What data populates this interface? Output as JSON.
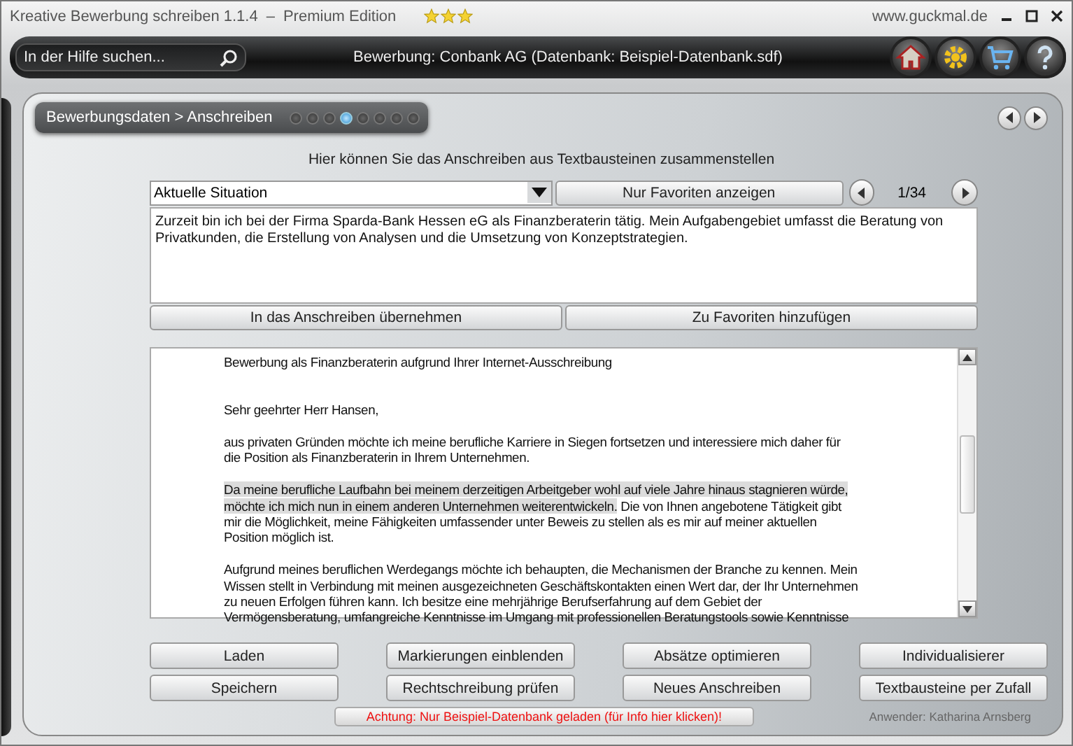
{
  "window": {
    "title": "Kreative Bewerbung schreiben 1.1.4",
    "separator": "–",
    "edition": "Premium Edition",
    "stars": 3,
    "website": "www.guckmal.de"
  },
  "toolbar": {
    "search": {
      "placeholder": "In der Hilfe suchen..."
    },
    "caption": "Bewerbung: Conbank AG (Datenbank: Beispiel-Datenbank.sdf)"
  },
  "breadcrumb": "Bewerbungsdaten > Anschreiben",
  "steps": [
    {
      "selected": false
    },
    {
      "selected": false
    },
    {
      "selected": false
    },
    {
      "selected": true
    },
    {
      "selected": false
    },
    {
      "selected": false
    },
    {
      "selected": false
    },
    {
      "selected": false
    }
  ],
  "heading": "Hier können Sie das Anschreiben aus Textbausteinen zusammenstellen",
  "category": "Aktuelle Situation",
  "favorites_button": "Nur Favoriten anzeigen",
  "pager": "1/34",
  "snippet": "Zurzeit bin ich bei der Firma Sparda-Bank Hessen eG als Finanzberaterin tätig. Mein Aufgabengebiet umfasst die Beratung von Privatkunden, die Erstellung von Analysen und die Umsetzung von Konzeptstrategien.",
  "snippet_buttons": [
    "In das Anschreiben übernehmen",
    "Zu Favoriten hinzufügen"
  ],
  "letter": [
    {
      "kind": "subject",
      "lines": [
        [
          {
            "text": "Bewerbung als Finanzberaterin aufgrund Ihrer Internet-Ausschreibung",
            "highlighted": false
          }
        ]
      ]
    },
    {
      "kind": "body",
      "lines": [
        [
          {
            "text": "Sehr geehrter Herr Hansen,",
            "highlighted": false
          }
        ]
      ]
    },
    {
      "kind": "body",
      "lines": [
        [
          {
            "text": "aus privaten Gründen möchte ich meine berufliche Karriere in Siegen fortsetzen und interessiere mich daher für",
            "highlighted": false
          }
        ],
        [
          {
            "text": "die Position als Finanzberaterin in Ihrem Unternehmen.",
            "highlighted": false
          }
        ]
      ]
    },
    {
      "kind": "body",
      "lines": [
        [
          {
            "text": "Da meine berufliche Laufbahn bei meinem derzeitigen Arbeitgeber wohl auf viele Jahre hinaus stagnieren würde,",
            "highlighted": true
          }
        ],
        [
          {
            "text": "möchte ich mich nun in einem anderen Unternehmen weiterentwickeln.",
            "highlighted": true
          },
          {
            "text": " Die von Ihnen angebotene Tätigkeit gibt",
            "highlighted": false
          }
        ],
        [
          {
            "text": "mir die Möglichkeit, meine Fähigkeiten umfassender unter Beweis zu stellen als es mir auf meiner aktuellen",
            "highlighted": false
          }
        ],
        [
          {
            "text": "Position möglich ist.",
            "highlighted": false
          }
        ]
      ]
    },
    {
      "kind": "body",
      "lines": [
        [
          {
            "text": "Aufgrund meines beruflichen Werdegangs möchte ich behaupten, die Mechanismen der Branche zu kennen. Mein",
            "highlighted": false
          }
        ],
        [
          {
            "text": "Wissen stellt in Verbindung mit meinen ausgezeichneten Geschäftskontakten einen Wert dar, der Ihr Unternehmen",
            "highlighted": false
          }
        ],
        [
          {
            "text": "zu neuen Erfolgen führen kann. Ich besitze eine mehrjährige Berufserfahrung auf dem Gebiet der",
            "highlighted": false
          }
        ],
        [
          {
            "text": "Vermögensberatung, umfangreiche Kenntnisse im Umgang mit professionellen Beratungstools sowie Kenntnisse",
            "highlighted": false
          }
        ]
      ]
    }
  ],
  "actions": [
    [
      "Laden",
      "Speichern"
    ],
    [
      "Markierungen einblenden",
      "Rechtschreibung prüfen"
    ],
    [
      "Absätze optimieren",
      "Neues Anschreiben"
    ],
    [
      "Individualisierer",
      "Textbausteine per Zufall"
    ]
  ],
  "warning": "Achtung: Nur Beispiel-Datenbank geladen (für Info hier klicken)!",
  "user": "Anwender: Katharina Arnsberg"
}
